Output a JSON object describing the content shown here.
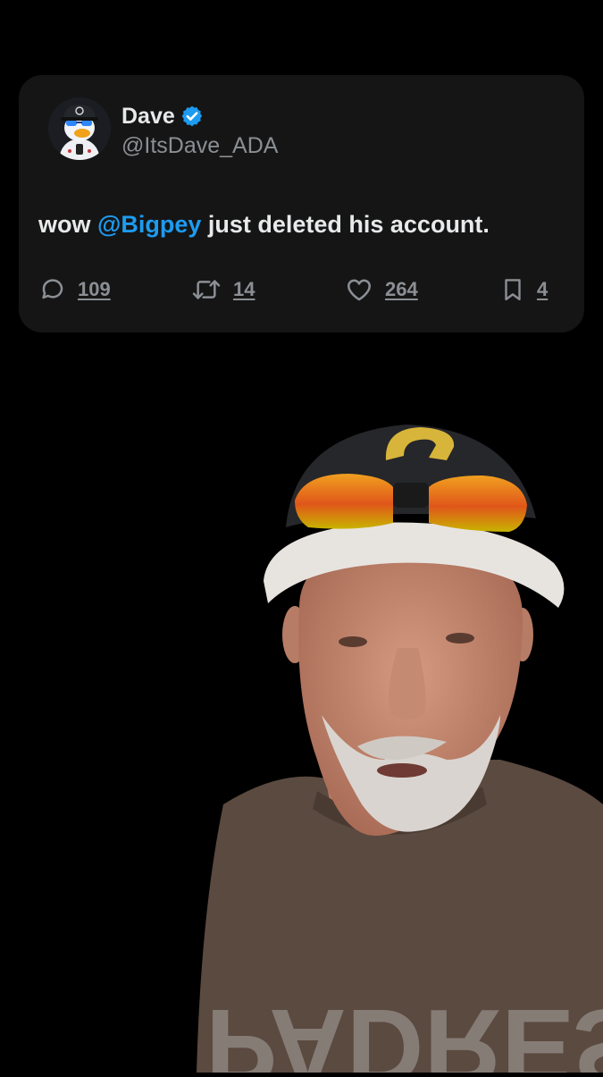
{
  "tweet": {
    "display_name": "Dave",
    "handle": "@ItsDave_ADA",
    "text_prefix": "wow ",
    "mention": "@Bigpey",
    "text_suffix": " just deleted his account.",
    "verified": true,
    "icons": {
      "avatar": "duck-avatar",
      "verified": "verified-badge-icon",
      "reply": "reply-icon",
      "repost": "repost-icon",
      "like": "heart-icon",
      "bookmark": "bookmark-icon"
    },
    "stats": {
      "replies": "109",
      "reposts": "14",
      "likes": "264",
      "bookmarks": "4"
    }
  },
  "video": {
    "shirt_text": "PADRES"
  },
  "colors": {
    "background": "#000000",
    "card": "#151515",
    "primary_text": "#e7e9ea",
    "secondary_text": "#8b8f94",
    "accent": "#1d9bf0"
  }
}
